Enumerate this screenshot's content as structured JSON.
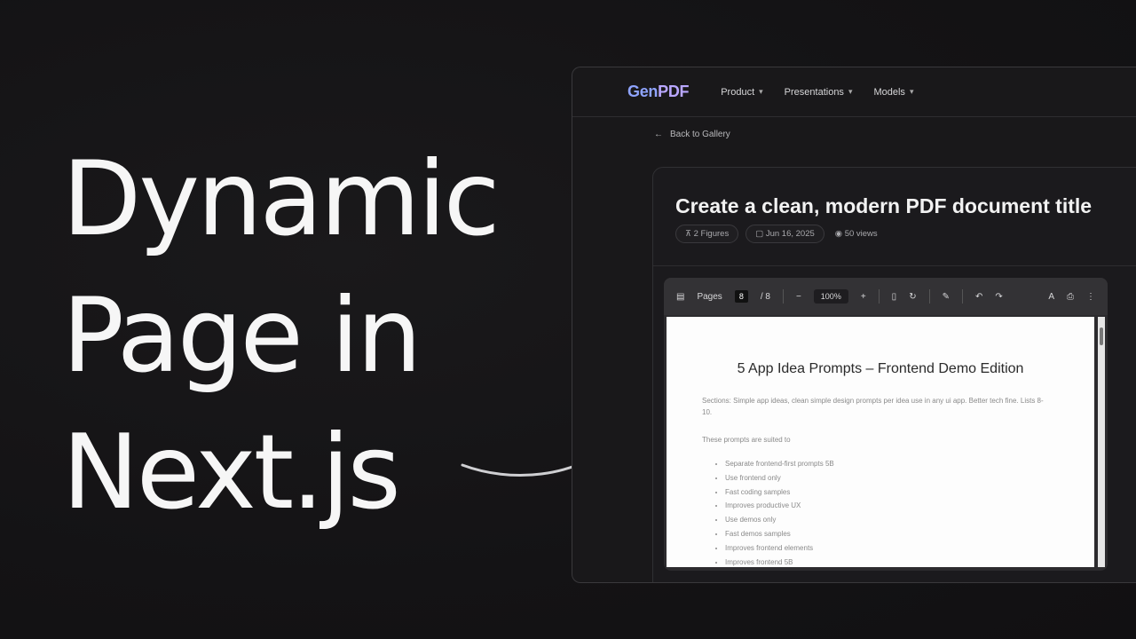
{
  "headline": [
    "Dynamic",
    "Page in",
    "Next.js"
  ],
  "app": {
    "logo_prefix": "Gen",
    "logo_suffix": "PDF",
    "nav": [
      {
        "label": "Product"
      },
      {
        "label": "Presentations"
      },
      {
        "label": "Models"
      }
    ]
  },
  "back_link": "Back to Gallery",
  "card": {
    "title": "Create a clean, modern PDF document title",
    "chips": [
      "2 Figures",
      "Jun 16, 2025"
    ],
    "views": "50 views"
  },
  "viewer": {
    "toolbar_label": "Pages",
    "page_number": "8",
    "page_total": "/ 8",
    "zoom": "100%"
  },
  "document": {
    "title": "5 App Idea Prompts – Frontend Demo Edition",
    "intro": "Sections: Simple app ideas, clean simple design prompts per idea use in any ui app. Better tech fine. Lists 8-10.",
    "subheading": "These prompts are suited to",
    "items": [
      "Separate frontend-first prompts 5B",
      "Use frontend only",
      "Fast coding samples",
      "Improves productive UX",
      "Use demos only",
      "Fast demos samples",
      "Improves frontend elements",
      "Improves frontend 5B"
    ]
  },
  "colors": {
    "accent": "#b9a7ff",
    "background": "#141315"
  }
}
